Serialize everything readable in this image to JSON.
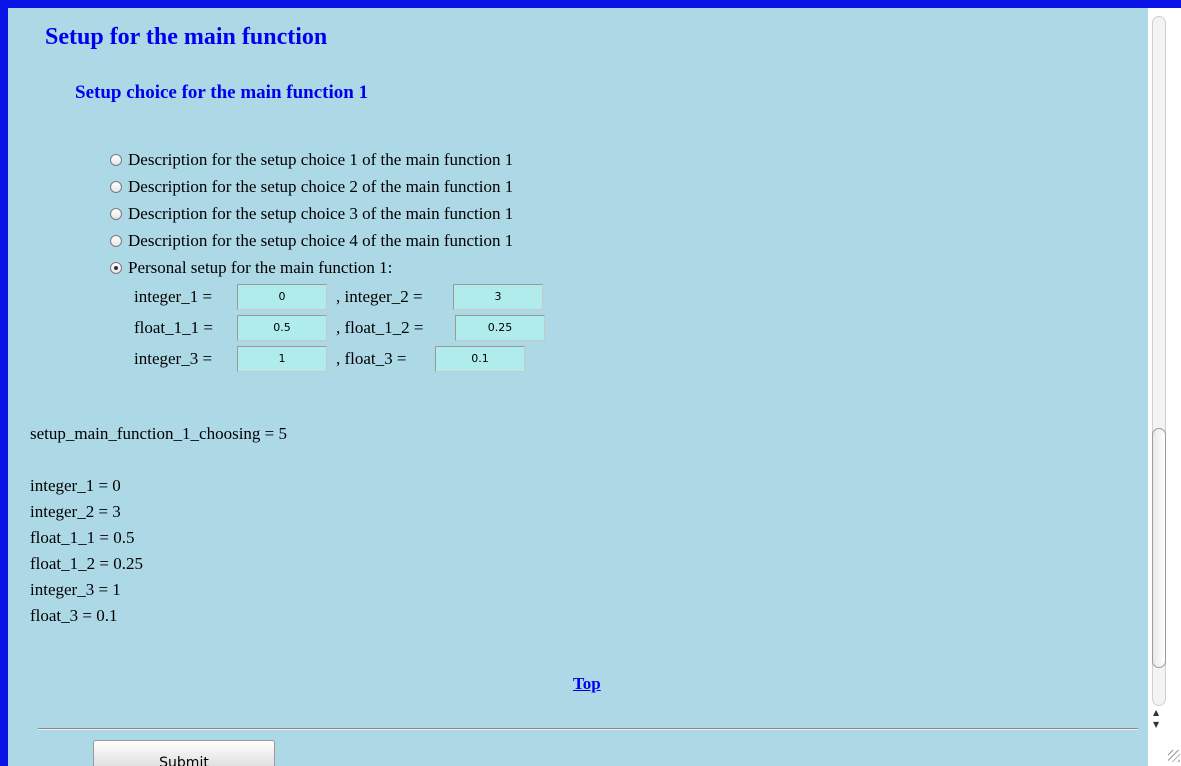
{
  "page": {
    "title": "Setup for the main function",
    "section_title": "Setup choice for the main function 1",
    "choices": [
      {
        "label": "Description for the setup choice 1 of the main function 1",
        "selected": false
      },
      {
        "label": "Description for the setup choice 2 of the main function 1",
        "selected": false
      },
      {
        "label": "Description for the setup choice 3 of the main function 1",
        "selected": false
      },
      {
        "label": "Description for the setup choice 4 of the main function 1",
        "selected": false
      },
      {
        "label": "Personal setup for the main function 1:",
        "selected": true
      }
    ],
    "fields": {
      "integer_1": {
        "label": "integer_1 =",
        "value": "0"
      },
      "integer_2": {
        "label": ", integer_2 =",
        "value": "3"
      },
      "float_1_1": {
        "label": "float_1_1 =",
        "value": "0.5"
      },
      "float_1_2": {
        "label": ", float_1_2 =",
        "value": "0.25"
      },
      "integer_3": {
        "label": "integer_3 =",
        "value": "1"
      },
      "float_3": {
        "label": ", float_3 =",
        "value": "0.1"
      }
    },
    "output": {
      "choosing": "setup_main_function_1_choosing = 5",
      "lines": [
        "integer_1 = 0",
        "integer_2 = 3",
        "float_1_1 = 0.5",
        "float_1_2 = 0.25",
        "integer_3 = 1",
        "float_3 = 0.1"
      ]
    },
    "top_link": "Top",
    "submit_label": "Submit"
  },
  "colors": {
    "outer_border": "#0a14e6",
    "panel_background": "#add8e6",
    "input_background": "#b0ecec",
    "heading": "#0000ee"
  }
}
